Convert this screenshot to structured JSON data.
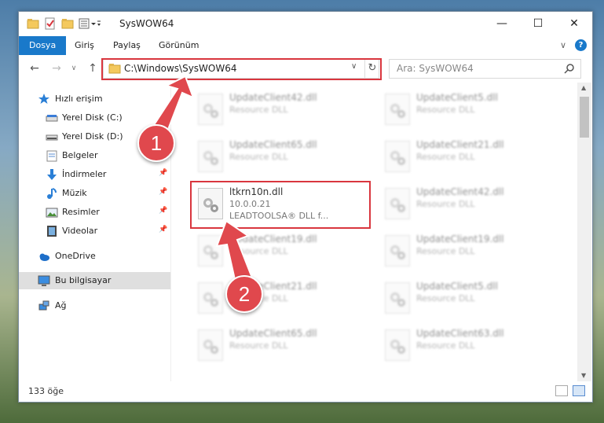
{
  "window": {
    "title": "SysWOW64",
    "minimize": "—",
    "maximize": "☐",
    "close": "✕"
  },
  "ribbon": {
    "tabs": [
      "Dosya",
      "Giriş",
      "Paylaş",
      "Görünüm"
    ],
    "help": "?",
    "expand": "∨"
  },
  "navbar": {
    "back": "←",
    "forward": "→",
    "recent": "∨",
    "up": "↑",
    "address": "C:\\Windows\\SysWOW64",
    "refresh": "↻",
    "search_placeholder": "Ara: SysWOW64"
  },
  "nav": {
    "items": [
      {
        "label": "Hızlı erişim",
        "icon": "star-icon"
      },
      {
        "label": "Yerel Disk (C:)",
        "icon": "drive-icon"
      },
      {
        "label": "Yerel Disk (D:)",
        "icon": "drive-icon"
      },
      {
        "label": "Belgeler",
        "icon": "documents-icon"
      },
      {
        "label": "İndirmeler",
        "icon": "download-icon"
      },
      {
        "label": "Müzik",
        "icon": "music-icon"
      },
      {
        "label": "Resimler",
        "icon": "pictures-icon"
      },
      {
        "label": "Videolar",
        "icon": "video-icon"
      },
      {
        "label": "OneDrive",
        "icon": "cloud-icon"
      },
      {
        "label": "Bu bilgisayar",
        "icon": "computer-icon"
      },
      {
        "label": "Ağ",
        "icon": "network-icon"
      }
    ]
  },
  "files": [
    {
      "name": "UpdateClient42.dll",
      "desc": "Resource DLL"
    },
    {
      "name": "UpdateClient5.dll",
      "desc": "Resource DLL"
    },
    {
      "name": "UpdateClient65.dll",
      "desc": "Resource DLL"
    },
    {
      "name": "UpdateClient21.dll",
      "desc": "Resource DLL"
    },
    {
      "name": "ltkrn10n.dll",
      "version": "10.0.0.21",
      "desc": "LEADTOOLSA® DLL f..."
    },
    {
      "name": "UpdateClient42.dll",
      "desc": "Resource DLL"
    },
    {
      "name": "UpdateClient19.dll",
      "desc": "Resource DLL"
    },
    {
      "name": "UpdateClient19.dll",
      "desc": "Resource DLL"
    },
    {
      "name": "UpdateClient21.dll",
      "desc": "Resource DLL"
    },
    {
      "name": "UpdateClient5.dll",
      "desc": "Resource DLL"
    },
    {
      "name": "UpdateClient65.dll",
      "desc": "Resource DLL"
    },
    {
      "name": "UpdateClient63.dll",
      "desc": "Resource DLL"
    }
  ],
  "status": {
    "count": "133 öğe"
  },
  "annotations": {
    "step1": "1",
    "step2": "2",
    "color": "#d9363e"
  },
  "colors": {
    "accent": "#1979ca",
    "highlight_box": "#d9363e",
    "arrow": "#e0484d"
  }
}
